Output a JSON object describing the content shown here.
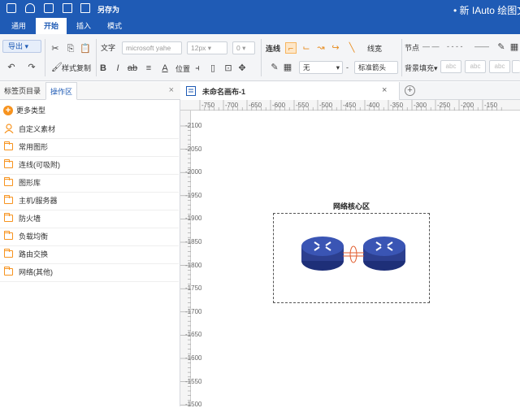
{
  "titlebar": {
    "save_as": "另存为",
    "app_title": "• 新 IAuto 绘图文"
  },
  "menu": {
    "items": [
      "通用",
      "开始",
      "插入",
      "模式"
    ],
    "active": "开始"
  },
  "ribbon": {
    "export_label": "导出",
    "style_copy": "样式复制",
    "text_label": "文字",
    "font_value": "microsoft yahe",
    "font_size": "12px",
    "spacing": "0",
    "connector_label": "连线",
    "line_width_label": "线宽",
    "node_label": "节点",
    "fill_none": "无",
    "arrow_style": "标准箭头",
    "bg_fill_label": "背景填充",
    "position_label": "位置",
    "style_sample": "abc"
  },
  "left_panel": {
    "tabs": [
      "标签页目录",
      "操作区"
    ],
    "active_tab": "操作区",
    "more_types": "更多类型",
    "categories": [
      {
        "label": "自定义素材",
        "icon": "user-icon"
      },
      {
        "label": "常用图形",
        "icon": "folder-icon"
      },
      {
        "label": "连线(可吸附)",
        "icon": "folder-icon"
      },
      {
        "label": "图形库",
        "icon": "folder-icon"
      },
      {
        "label": "主机/服务器",
        "icon": "folder-icon"
      },
      {
        "label": "防火墙",
        "icon": "folder-icon"
      },
      {
        "label": "负载均衡",
        "icon": "folder-icon"
      },
      {
        "label": "路由交换",
        "icon": "folder-icon"
      },
      {
        "label": "网络(其他)",
        "icon": "folder-icon"
      }
    ]
  },
  "document": {
    "tab_title": "未命名画布-1"
  },
  "ruler": {
    "horizontal": [
      "-750",
      "-700",
      "-650",
      "-600",
      "-550",
      "-500",
      "-450",
      "-400",
      "-350",
      "-300",
      "-250",
      "-200",
      "-150"
    ],
    "vertical": [
      "-2100",
      "-2050",
      "-2000",
      "-1950",
      "-1900",
      "-1850",
      "-1800",
      "-1750",
      "-1700",
      "-1650",
      "-1600",
      "-1550",
      "-1500"
    ]
  },
  "diagram": {
    "group_title": "网络核心区",
    "router_color": "#2c3f8f",
    "link_color": "#e15a2a"
  }
}
